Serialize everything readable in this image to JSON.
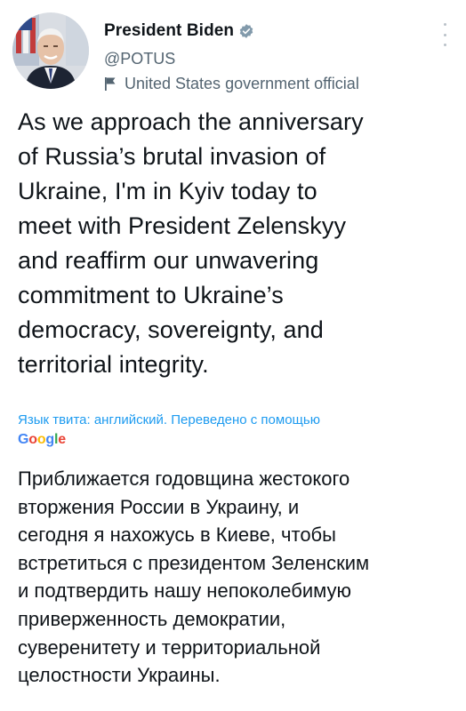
{
  "author": {
    "display_name": "President Biden",
    "handle": "@POTUS",
    "label": "United States government official",
    "avatar_icon": "portrait-avatar",
    "verified_icon": "verified-badge-icon",
    "label_icon": "government-flag-icon",
    "verified_color": "#1d9bf0"
  },
  "menu": {
    "icon": "more-options-icon"
  },
  "tweet": {
    "text": "As we approach the anniversary\nof Russia’s brutal invasion of\nUkraine, I'm in Kyiv today to\nmeet with President Zelenskyy\nand reaffirm our unwavering\ncommitment to Ukraine’s\ndemocracy, sovereignty, and\nterritorial integrity."
  },
  "translation": {
    "notice": "Язык твита: английский. Переведено с помощью",
    "provider": "Google",
    "text": "Приближается годовщина жестокого\nвторжения России в Украину, и\nсегодня я нахожусь в Киеве, чтобы\nвстретиться с президентом Зеленским\nи подтвердить нашу непоколебимую\nприверженность демократии,\nсуверенитету и территориальной\nцелостности Украины.",
    "link_color": "#1d9bf0"
  },
  "colors": {
    "text": "#0f1419",
    "secondary": "#536471"
  }
}
